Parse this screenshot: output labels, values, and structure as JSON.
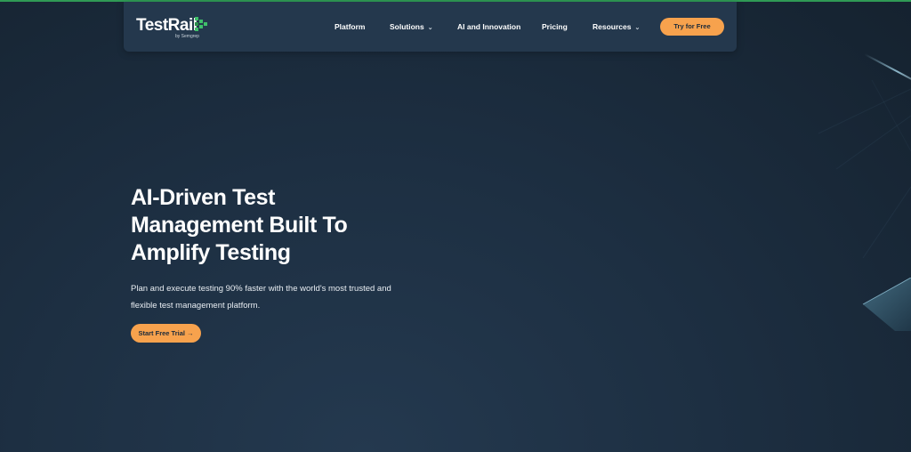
{
  "brand": {
    "name": "TestRail",
    "sub": "by Semgrep",
    "accent": "#f7a24d",
    "logo_green": "#3fbf6a",
    "topline": "#2f9a55"
  },
  "nav": {
    "items": [
      {
        "label": "Platform",
        "dropdown": false
      },
      {
        "label": "Solutions",
        "dropdown": true
      },
      {
        "label": "AI and Innovation",
        "dropdown": false
      },
      {
        "label": "Pricing",
        "dropdown": false
      },
      {
        "label": "Resources",
        "dropdown": true
      }
    ],
    "cta": "Try for Free",
    "chevron_icon": "chevron-down-icon"
  },
  "hero": {
    "title": "AI-Driven Test Management Built To Amplify Testing",
    "subtitle": "Plan and execute testing 90% faster with the world's most trusted and flexible test management platform.",
    "cta": "Start Free Trial →"
  }
}
